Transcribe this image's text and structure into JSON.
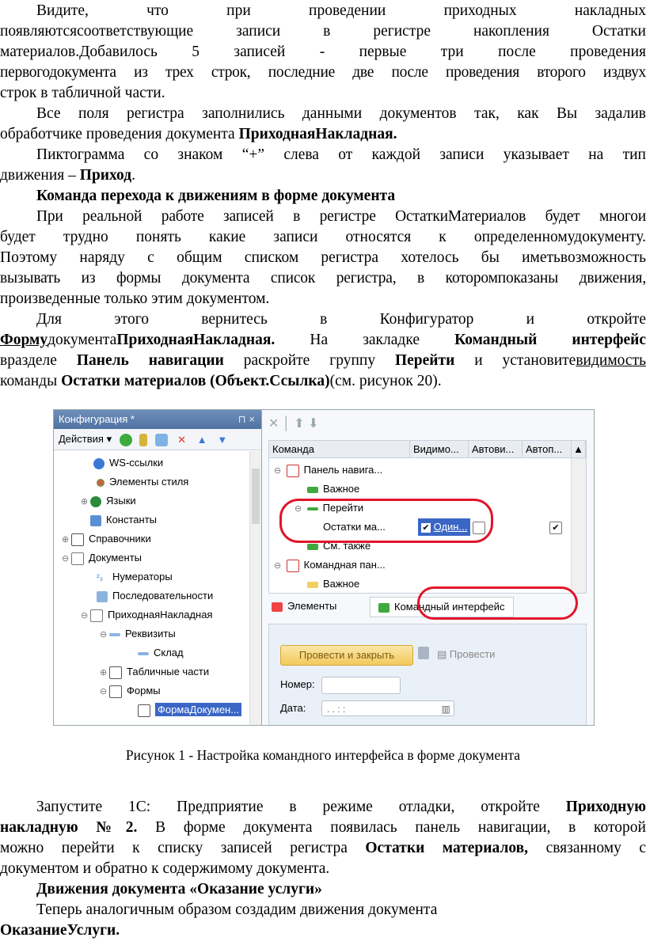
{
  "paragraphs": {
    "p1": {
      "line1": "Видите, что при проведении приходных накладных",
      "line2": "появляютсясоответствующие записи в регистре накопления Остатки",
      "line3": "материалов.Добавилось 5 записей - первые три после проведения",
      "line4": "первогодокумента из трех строк, последние две после проведения второго издвух",
      "line5": "строк в табличной части."
    },
    "p2": {
      "line1": "Все поля регистра заполнились данными документов так, как Вы задалив",
      "line2_text": "обработчике проведения документа ",
      "line2_bold": "ПриходнаяНакладная."
    },
    "p3": {
      "line1": "Пиктограмма со знаком “+” слева от каждой записи указывает на тип",
      "line2_text": "движения – ",
      "line2_bold": "Приход",
      "line2_end": "."
    },
    "heading1": "Команда перехода к движениям в форме документа",
    "p4": {
      "line1": "При реальной работе записей в регистре ОстаткиМатериалов будет многои",
      "line2": "будет трудно понять какие записи относятся к определенномудокументу.",
      "line3": "Поэтому наряду с общим списком регистра хотелось бы иметьвозможность",
      "line4": "вызывать из формы документа список регистра, в которомпоказаны движения,",
      "line5": "произведенные только этим документом."
    },
    "p5": {
      "line1": "Для этого вернитесь в Конфигуратор и откройте",
      "l2_a": "Форму",
      "l2_b": "документа",
      "l2_c": "ПриходнаяНакладная.",
      "l2_d": " На закладке ",
      "l2_e": "Командный интерфейс",
      "l3_a": "вразделе ",
      "l3_b": "Панель навигации",
      "l3_c": " раскройте группу ",
      "l3_d": "Перейти",
      "l3_e": " и установите",
      "l3_f": "видимость",
      "l4_a": "команды ",
      "l4_b": "Остатки материалов (Объект.Ссылка)",
      "l4_c": "(см. рисунок 20)."
    },
    "p6": {
      "l1_a": "Запустите 1С: Предприятие в режиме отладки, откройте ",
      "l1_b": "Приходную",
      "l2_a": "накладную №2.",
      "l2_b": " В форме документа появилась панель навигации, в которой",
      "l3_a": "можно перейти к списку записей регистра ",
      "l3_b": "Остатки материалов,",
      "l3_c": " связанному с",
      "l4": "документом и обратно к содержимому документа."
    },
    "heading2": "Движения документа «Оказание услуги»",
    "p7": {
      "line1": "Теперь аналогичным образом создадим движения документа",
      "line2_bold": "ОказаниеУслуги."
    }
  },
  "figure": {
    "caption": "Рисунок 1 - Настройка командного интерфейса в форме документа",
    "left_panel": {
      "title": "Конфигурация *",
      "pin": "⊓ ×",
      "actions_label": "Действия ▾",
      "tree": [
        "WS-ссылки",
        "Элементы стиля",
        "Языки",
        "Константы",
        "Справочники",
        "Документы",
        "Нумераторы",
        "Последовательности",
        "ПриходнаяНакладная",
        "Реквизиты",
        "Склад",
        "Табличные части",
        "Формы",
        "ФормаДокумен..."
      ]
    },
    "right_panel": {
      "headers": [
        "Команда",
        "Видимо...",
        "Автови...",
        "Автоп..."
      ],
      "rows": [
        "Панель навига...",
        "Важное",
        "Перейти",
        "Остатки ма...",
        "См. также",
        "Командная пан...",
        "Важное"
      ],
      "one_label": "Один...",
      "tab_elements": "Элементы",
      "tab_command": "Командный интерфейс",
      "btn_post_close": "Провести и закрыть",
      "btn_post": "Провести",
      "label_number": "Номер:",
      "label_date": "Дата:",
      "date_mask": ". .   : :"
    }
  },
  "colors": {
    "highlight_red": "#e0152b",
    "title_blue": "#4f73a3",
    "selection_blue": "#3a66c6",
    "button_yellow": "#f2c95c"
  }
}
